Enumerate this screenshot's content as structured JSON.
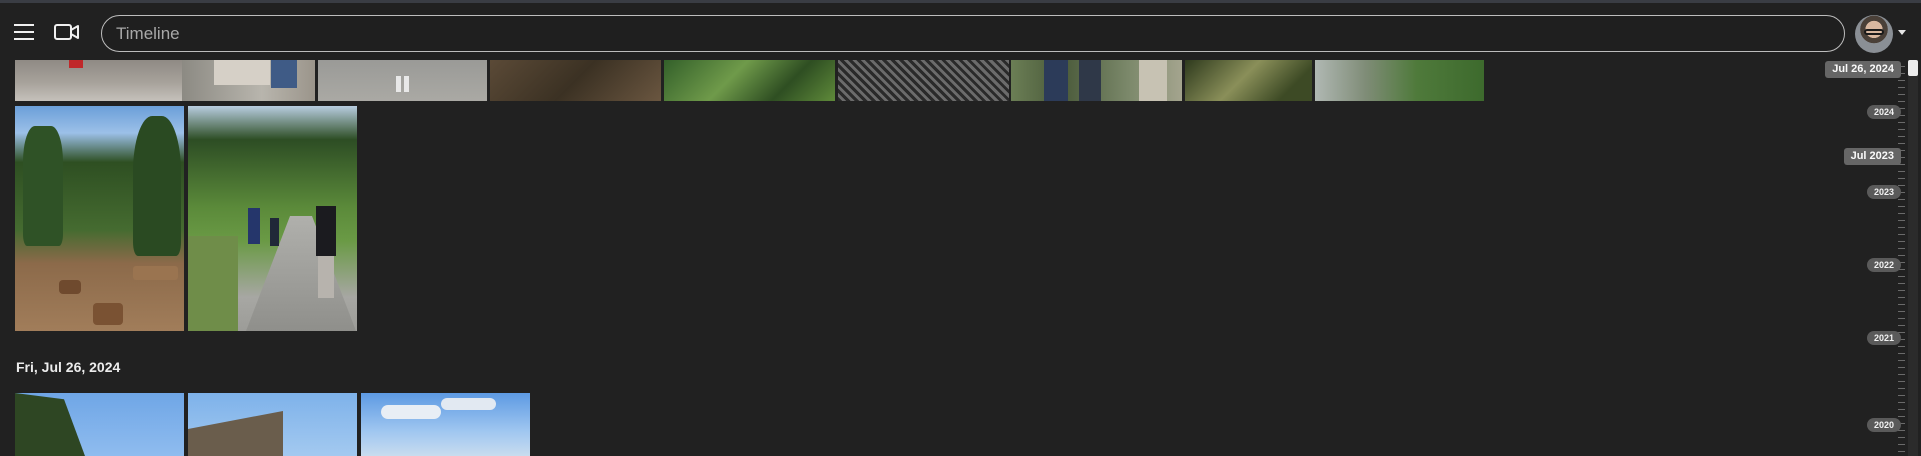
{
  "search": {
    "placeholder": "Timeline"
  },
  "timeline": {
    "day_heading": "Fri, Jul 26, 2024"
  },
  "scrubber": {
    "current_date": "Jul 26, 2024",
    "hover_date": "Jul 2023",
    "years": [
      "2024",
      "2023",
      "2022",
      "2021",
      "2020"
    ]
  },
  "icons": {
    "menu": "menu-icon",
    "video": "video-camera-icon",
    "avatar": "user-avatar",
    "dropdown": "chevron-down-icon"
  },
  "colors": {
    "background": "#212121",
    "topbar_border": "#3a3d44",
    "pill_background": "#5a5a5a"
  }
}
